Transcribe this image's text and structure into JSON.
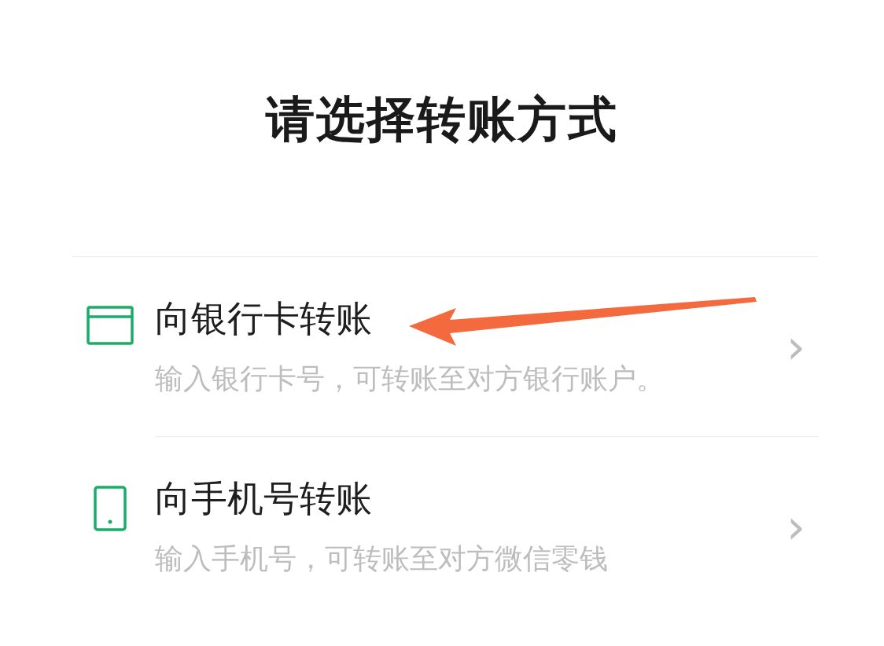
{
  "title": "请选择转账方式",
  "options": [
    {
      "kind": "card",
      "label": "向银行卡转账",
      "description": "输入银行卡号，可转账至对方银行账户。",
      "chevron": "›"
    },
    {
      "kind": "phone",
      "label": "向手机号转账",
      "description": "输入手机号，可转账至对方微信零钱",
      "chevron": "›"
    }
  ],
  "annotation": {
    "kind": "arrow",
    "color": "#f26a3d"
  }
}
